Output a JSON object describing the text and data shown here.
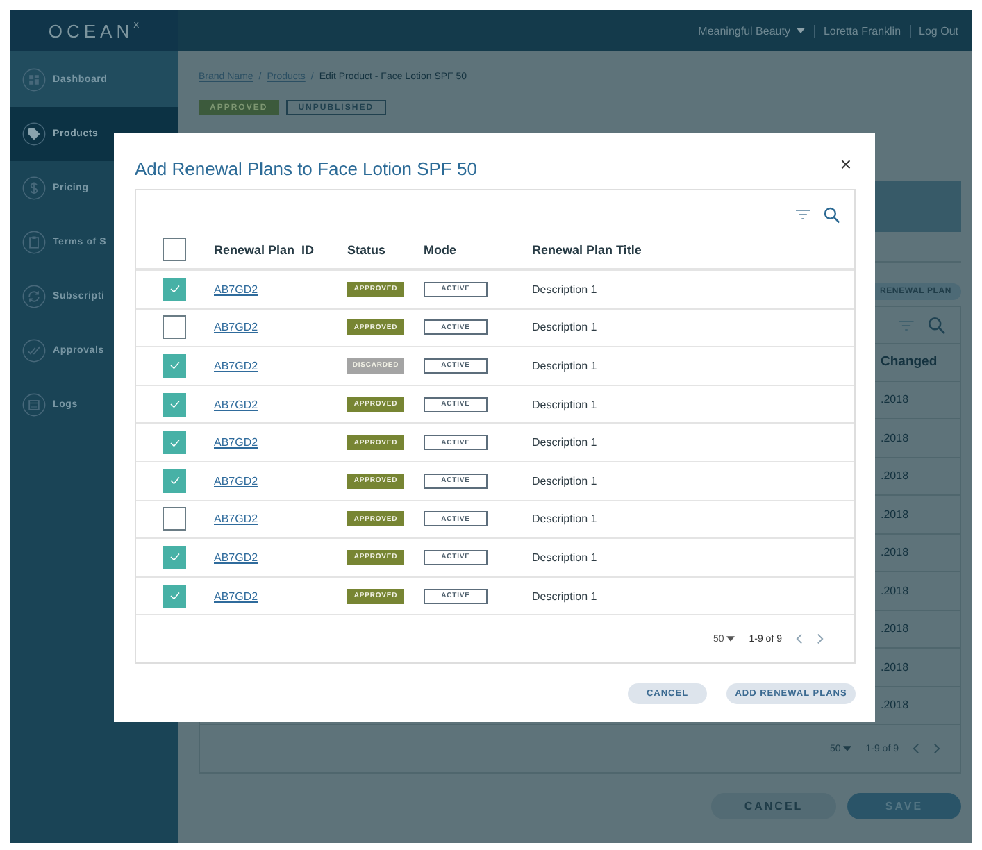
{
  "header": {
    "logo": "OCEAN",
    "logo_superscript": "x",
    "brand_menu": "Meaningful Beauty",
    "user": "Loretta Franklin",
    "logout": "Log Out"
  },
  "sidebar": {
    "items": [
      {
        "label": "Dashboard",
        "selected": false
      },
      {
        "label": "Products",
        "selected": true
      },
      {
        "label": "Pricing",
        "selected": false
      },
      {
        "label": "Terms of S",
        "selected": false
      },
      {
        "label": "Subscripti",
        "selected": false
      },
      {
        "label": "Approvals",
        "selected": false
      },
      {
        "label": "Logs",
        "selected": false
      }
    ]
  },
  "breadcrumb": [
    {
      "label": "Brand Name",
      "link": true
    },
    {
      "separator": "/",
      "label": "Products",
      "link": true
    },
    {
      "separator": "/",
      "label": "Edit Product - Face Lotion SPF 50",
      "link": false
    }
  ],
  "badges": [
    {
      "label": "APPROVED",
      "kind": "filled"
    },
    {
      "label": "UNPUBLISHED",
      "kind": "outline"
    }
  ],
  "background_table": {
    "button": "RENEWAL PLAN",
    "column_header": "Changed",
    "rows": [
      ".2018",
      ".2018",
      ".2018",
      ".2018",
      ".2018",
      ".2018",
      ".2018",
      ".2018",
      ".2018"
    ],
    "pagination": {
      "page_size": "50",
      "range": "1-9 of 9"
    }
  },
  "form_buttons": [
    {
      "label": "CANCEL",
      "kind": "secondary"
    },
    {
      "label": "SAVE",
      "kind": "primary"
    }
  ],
  "modal": {
    "title": "Add Renewal Plans to Face Lotion SPF 50",
    "close": "×",
    "select_all": {
      "checked": false
    },
    "columns": [
      "Renewal Plan  ID",
      "Status",
      "Mode",
      "Renewal Plan Title"
    ],
    "rows": [
      {
        "checked": true,
        "id": "AB7GD2",
        "status": "APPROVED",
        "color": "#778533",
        "mode": "ACTIVE",
        "title": "Description 1"
      },
      {
        "checked": false,
        "id": "AB7GD2",
        "status": "APPROVED",
        "color": "#778533",
        "mode": "ACTIVE",
        "title": "Description 1"
      },
      {
        "checked": true,
        "id": "AB7GD2",
        "status": "DISCARDED",
        "color": "#a4a4a4",
        "mode": "ACTIVE",
        "title": "Description 1"
      },
      {
        "checked": true,
        "id": "AB7GD2",
        "status": "APPROVED",
        "color": "#778533",
        "mode": "ACTIVE",
        "title": "Description 1"
      },
      {
        "checked": true,
        "id": "AB7GD2",
        "status": "APPROVED",
        "color": "#778533",
        "mode": "ACTIVE",
        "title": "Description 1"
      },
      {
        "checked": true,
        "id": "AB7GD2",
        "status": "APPROVED",
        "color": "#778533",
        "mode": "ACTIVE",
        "title": "Description 1"
      },
      {
        "checked": false,
        "id": "AB7GD2",
        "status": "APPROVED",
        "color": "#778533",
        "mode": "ACTIVE",
        "title": "Description 1"
      },
      {
        "checked": true,
        "id": "AB7GD2",
        "status": "APPROVED",
        "color": "#778533",
        "mode": "ACTIVE",
        "title": "Description 1"
      },
      {
        "checked": true,
        "id": "AB7GD2",
        "status": "APPROVED",
        "color": "#778533",
        "mode": "ACTIVE",
        "title": "Description 1"
      }
    ],
    "pagination": {
      "page_size": "50",
      "range": "1-9 of 9"
    },
    "buttons": [
      {
        "label": "CANCEL",
        "kind": "secondary"
      },
      {
        "label": "ADD RENEWAL PLANS",
        "kind": "primary"
      }
    ]
  }
}
